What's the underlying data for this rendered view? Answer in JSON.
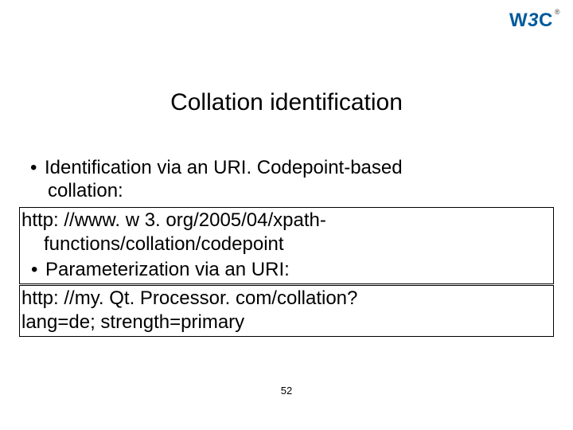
{
  "logo": {
    "text": "W3C",
    "registered": "®"
  },
  "title": "Collation identification",
  "bullets": {
    "b1_line1": "Identification via an URI. Codepoint-based",
    "b1_line2": "collation:",
    "box1_line1": "http: //www. w 3. org/2005/04/xpath-",
    "box1_line2": "functions/collation/codepoint",
    "b2": "Parameterization via an URI:",
    "box2_line1": "http: //my. Qt. Processor. com/collation?",
    "box2_line2": "lang=de; strength=primary"
  },
  "page_number": "52"
}
